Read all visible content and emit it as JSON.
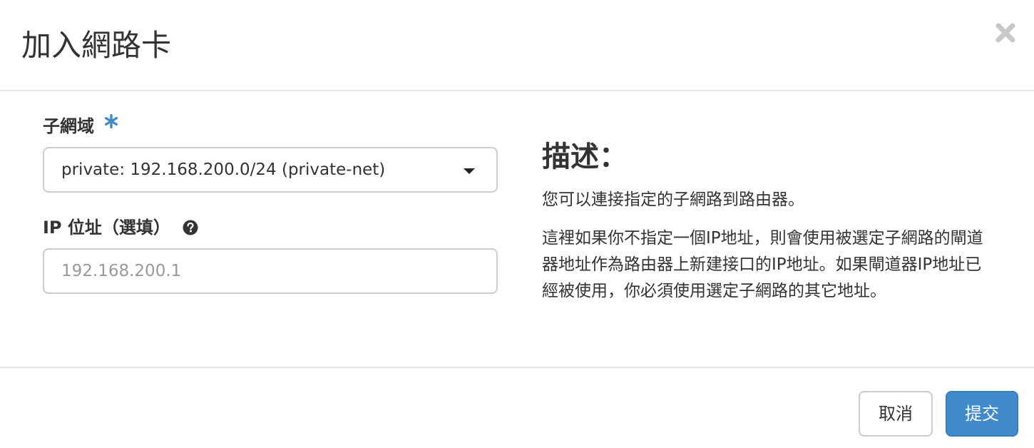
{
  "modal": {
    "title": "加入網路卡",
    "close_icon": "close-icon"
  },
  "form": {
    "subnet": {
      "label": "子網域",
      "required_icon": "asterisk-icon",
      "required_color": "#428bca",
      "selected_value": "private: 192.168.200.0/24 (private-net)",
      "caret_icon": "caret-down-icon"
    },
    "ip_address": {
      "label": "IP 位址（選填）",
      "help_icon": "question-circle-icon",
      "value": "",
      "placeholder": "192.168.200.1"
    }
  },
  "description": {
    "title": "描述：",
    "paragraphs": [
      "您可以連接指定的子網路到路由器。",
      "這裡如果你不指定一個IP地址，則會使用被選定子網路的閘道器地址作為路由器上新建接口的IP地址。如果閘道器IP地址已經被使用，你必須使用選定子網路的其它地址。"
    ]
  },
  "footer": {
    "cancel_label": "取消",
    "submit_label": "提交",
    "submit_color": "#428bca"
  }
}
